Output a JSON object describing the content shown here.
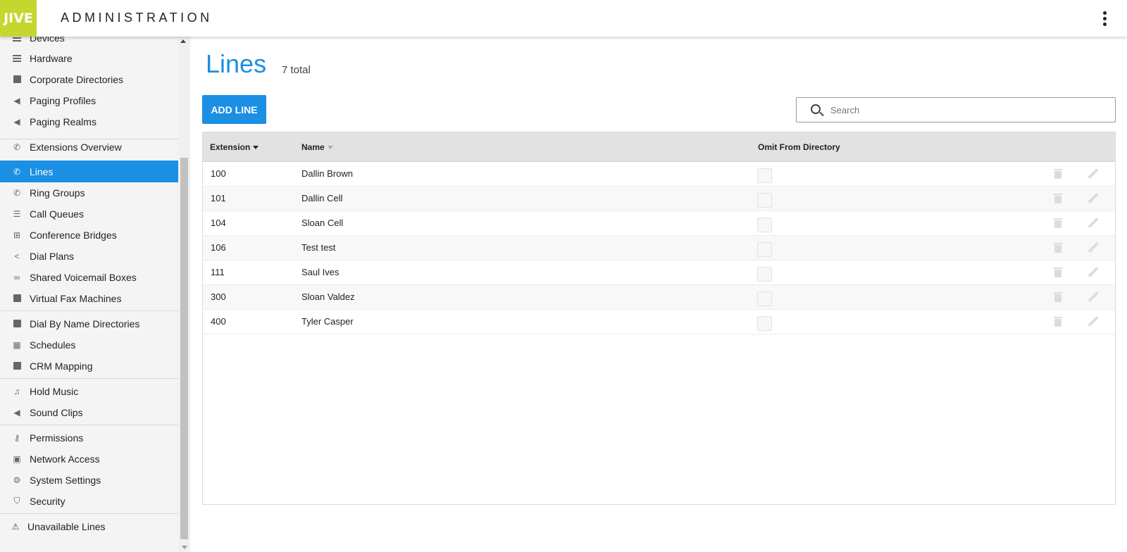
{
  "header": {
    "logo_text": "JIVE",
    "title": "ADMINISTRATION"
  },
  "sidebar": {
    "items": [
      {
        "label": "Devices",
        "icon": "devices-icon"
      },
      {
        "label": "Hardware",
        "icon": "hardware-icon"
      },
      {
        "label": "Corporate Directories",
        "icon": "directory-icon"
      },
      {
        "label": "Paging Profiles",
        "icon": "megaphone-icon"
      },
      {
        "label": "Paging Realms",
        "icon": "megaphone-icon"
      },
      {
        "label": "Extensions Overview",
        "icon": "phone-icon"
      },
      {
        "label": "Lines",
        "icon": "phone-icon"
      },
      {
        "label": "Ring Groups",
        "icon": "ring-group-icon"
      },
      {
        "label": "Call Queues",
        "icon": "list-icon"
      },
      {
        "label": "Conference Bridges",
        "icon": "conference-icon"
      },
      {
        "label": "Dial Plans",
        "icon": "share-icon"
      },
      {
        "label": "Shared Voicemail Boxes",
        "icon": "voicemail-icon"
      },
      {
        "label": "Virtual Fax Machines",
        "icon": "fax-icon"
      },
      {
        "label": "Dial By Name Directories",
        "icon": "directory-icon"
      },
      {
        "label": "Schedules",
        "icon": "calendar-icon"
      },
      {
        "label": "CRM Mapping",
        "icon": "crm-icon"
      },
      {
        "label": "Hold Music",
        "icon": "music-icon"
      },
      {
        "label": "Sound Clips",
        "icon": "speaker-icon"
      },
      {
        "label": "Permissions",
        "icon": "key-icon"
      },
      {
        "label": "Network Access",
        "icon": "lock-icon"
      },
      {
        "label": "System Settings",
        "icon": "gear-icon"
      },
      {
        "label": "Security",
        "icon": "shield-icon"
      },
      {
        "label": "Unavailable Lines",
        "icon": "warning-icon"
      }
    ],
    "active": "Lines"
  },
  "main": {
    "title": "Lines",
    "count": "7 total",
    "add_button": "ADD LINE",
    "search_placeholder": "Search",
    "columns": [
      "Extension",
      "Name",
      "Omit From Directory"
    ],
    "rows": [
      {
        "extension": "100",
        "name": "Dallin Brown",
        "omit": false
      },
      {
        "extension": "101",
        "name": "Dallin Cell",
        "omit": false
      },
      {
        "extension": "104",
        "name": "Sloan Cell",
        "omit": false
      },
      {
        "extension": "106",
        "name": "Test test",
        "omit": false
      },
      {
        "extension": "111",
        "name": "Saul Ives",
        "omit": false
      },
      {
        "extension": "300",
        "name": "Sloan Valdez",
        "omit": false
      },
      {
        "extension": "400",
        "name": "Tyler Casper",
        "omit": false
      }
    ]
  },
  "colors": {
    "accent": "#1a8fe3",
    "logo": "#c5d62e"
  }
}
